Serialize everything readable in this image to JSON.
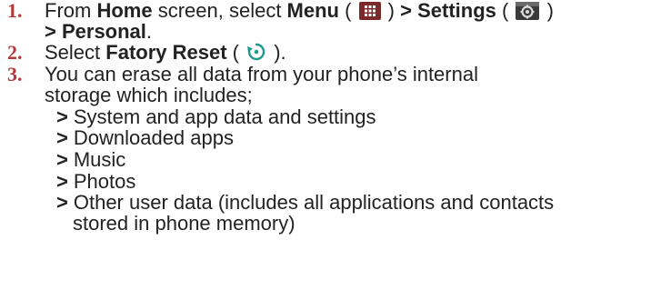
{
  "steps": [
    {
      "number": "1.",
      "line1": {
        "t1": "From ",
        "home": "Home",
        "t2": " screen",
        "t3": ", select ",
        "menu": "Menu",
        "t4": " ( ",
        "t5": " ) ",
        "gt": ">",
        "t6": " ",
        "settings": "Settings",
        "t7": " ( ",
        "t8": " )"
      },
      "line2": {
        "gt": ">",
        "personal": " Personal",
        "dot": "."
      },
      "icons": [
        "menu-grid-icon",
        "settings-gear-icon"
      ]
    },
    {
      "number": "2.",
      "line1": {
        "t1": "Select ",
        "reset": "Fatory Reset",
        "t2": " ( ",
        "t3": " )."
      },
      "icons": [
        "factory-reset-icon"
      ]
    },
    {
      "number": "3.",
      "line1": "You can erase all data from your phone’s internal",
      "line2": "storage which includes;"
    }
  ],
  "storage_items": [
    "System and app data and settings",
    "Downloaded apps",
    "Music",
    "Photos",
    "Other user data (includes all applications and contacts"
  ],
  "storage_item_continuation": "stored in phone memory)",
  "bullet_symbol": ">",
  "colors": {
    "step_number": "#b23a3a",
    "text": "#222222",
    "menu_icon_bg": "#7a2a2a",
    "settings_icon_bg": "#3a3a3a",
    "reset_icon": "#1e9b8f"
  }
}
